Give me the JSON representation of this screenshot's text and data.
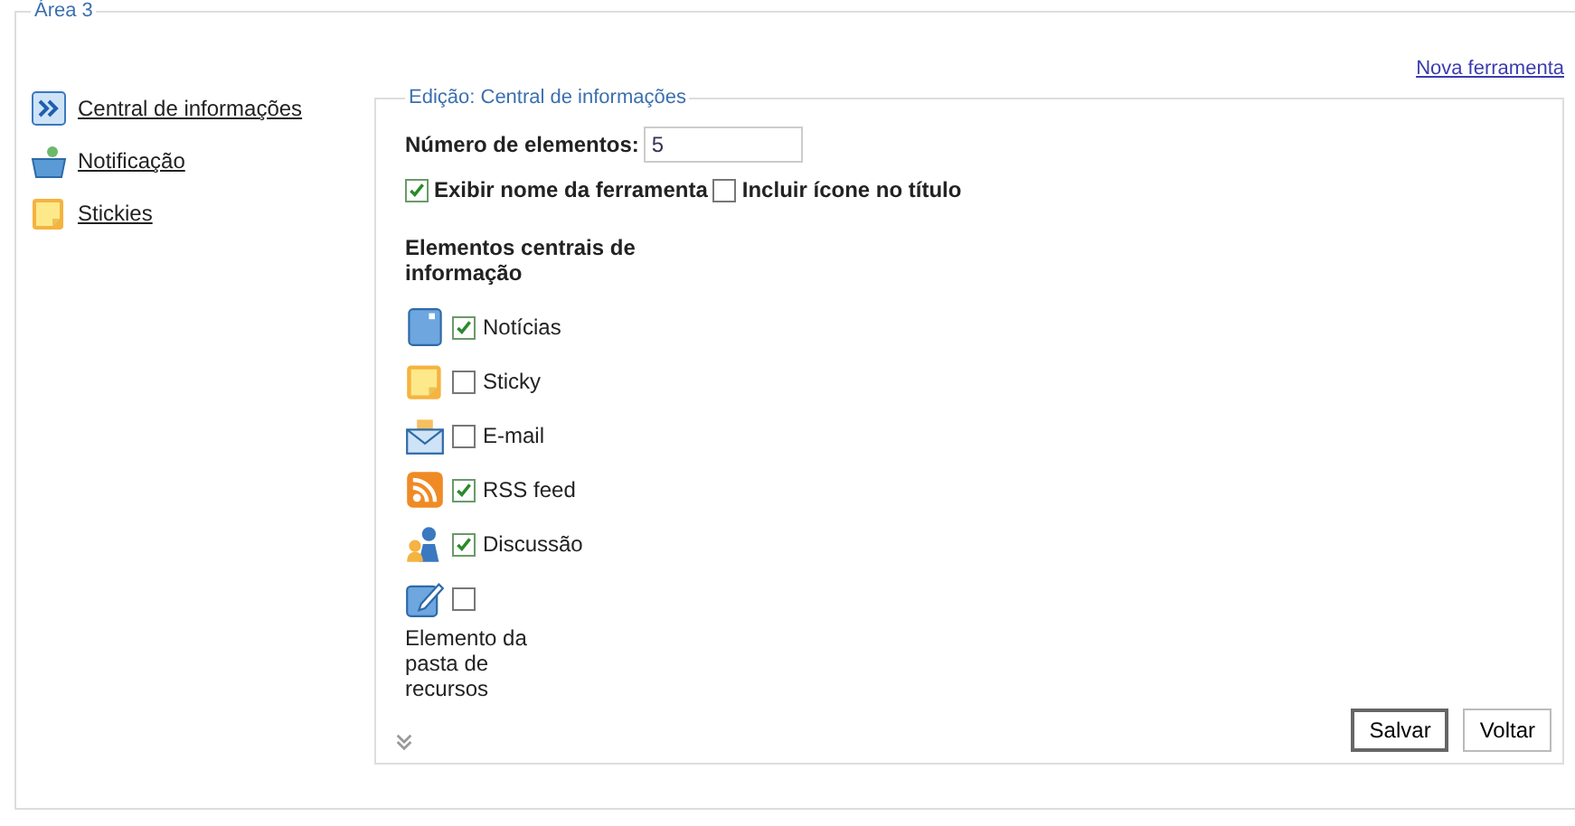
{
  "area": {
    "legend": "Área 3"
  },
  "sidebar": {
    "items": [
      {
        "label": "Central de informações",
        "kind": "central"
      },
      {
        "label": "Notificação",
        "kind": "notification"
      },
      {
        "label": "Stickies",
        "kind": "sticky"
      }
    ]
  },
  "new_tool_link": "Nova ferramenta",
  "edit_panel": {
    "legend": "Edição: Central de informações",
    "count_label": "Número de elementos:",
    "count_value": "5",
    "options": [
      {
        "label": "Exibir nome da ferramenta",
        "checked": true
      },
      {
        "label": "Incluir ícone no título",
        "checked": false
      }
    ],
    "elements_heading": "Elementos centrais de informação",
    "elements": [
      {
        "label": "Notícias",
        "kind": "news",
        "checked": true
      },
      {
        "label": "Sticky",
        "kind": "sticky",
        "checked": false
      },
      {
        "label": "E-mail",
        "kind": "mail",
        "checked": false
      },
      {
        "label": "RSS feed",
        "kind": "rss",
        "checked": true
      },
      {
        "label": "Discussão",
        "kind": "discussion",
        "checked": true
      },
      {
        "label": "Elemento da pasta de recursos",
        "kind": "resource",
        "checked": false
      }
    ],
    "buttons": [
      "Salvar",
      "Voltar"
    ]
  }
}
